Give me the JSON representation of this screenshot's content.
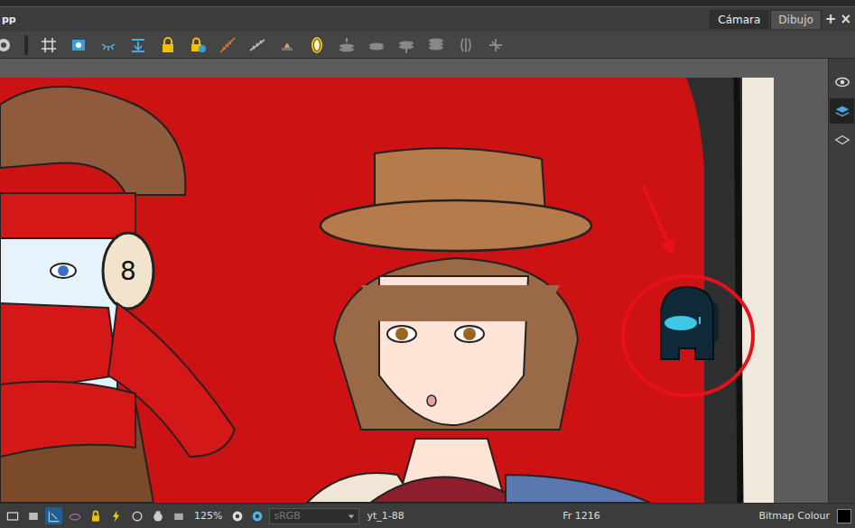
{
  "window": {
    "title": "pp"
  },
  "view_tabs": [
    {
      "label": "Cámara",
      "selected": true
    },
    {
      "label": "Dibujo",
      "selected": false
    }
  ],
  "tab_actions": [
    "+",
    "×"
  ],
  "side_panel": [
    {
      "selected": false
    },
    {
      "selected": true
    },
    {
      "selected": false
    }
  ],
  "artwork": {
    "label": "8"
  },
  "status_bar": {
    "toggles": [
      {
        "selected": false
      },
      {
        "selected": false
      },
      {
        "selected": true
      },
      {
        "selected": false
      },
      {
        "selected": false
      },
      {
        "selected": false
      },
      {
        "selected": false
      },
      {
        "selected": false
      },
      {
        "selected": false
      }
    ],
    "zoom": "125%",
    "color_space": "sRGB",
    "color_space_disabled": true,
    "drawing": "yt_1-88",
    "frame": "Fr 1216",
    "layer_type": "Bitmap Colour",
    "current_color": "#000000"
  }
}
